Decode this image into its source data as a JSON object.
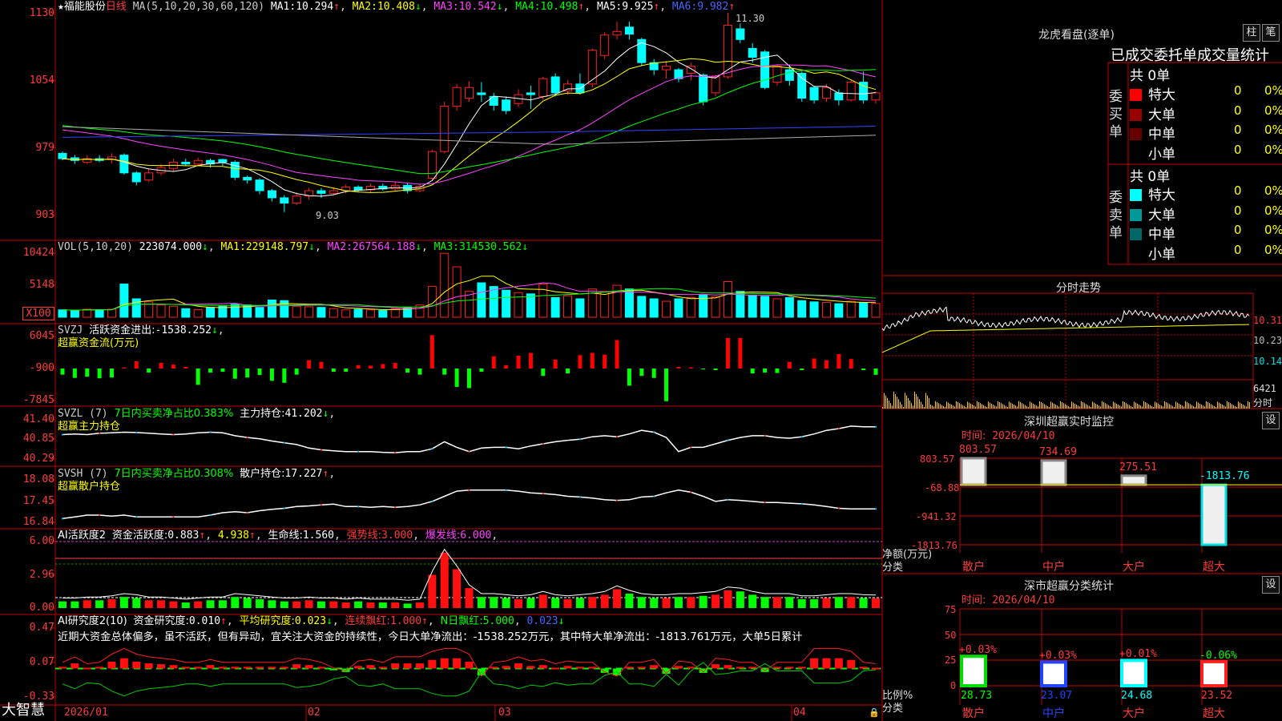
{
  "app_name": "大智慧",
  "colors": {
    "up": "#ff2020",
    "down": "#00ffff",
    "grid": "#c00000",
    "label": "#ff3b3b",
    "ma1": "#ffffff",
    "ma2": "#ffff00",
    "ma3": "#ff44ff",
    "ma4": "#00ff00",
    "ma5": "#3344ff",
    "ma6": "#aaaaaa"
  },
  "main": {
    "star": "★",
    "stock_name": "福能股份",
    "period": "日线",
    "ma_title": "MA(5,10,20,30,60,120)",
    "ma": [
      {
        "label": "MA1:",
        "value": "10.294",
        "arrow": "↑"
      },
      {
        "label": "MA2:",
        "value": "10.408",
        "arrow": "↓"
      },
      {
        "label": "MA3:",
        "value": "10.542",
        "arrow": "↓"
      },
      {
        "label": "MA4:",
        "value": "10.498",
        "arrow": "↑"
      },
      {
        "label": "MA5:",
        "value": "9.925",
        "arrow": "↑"
      },
      {
        "label": "MA6:",
        "value": "9.982",
        "arrow": "↑"
      }
    ],
    "y_ticks": [
      "1130",
      "1054",
      "979",
      "903"
    ],
    "high_label": "11.30",
    "low_label": "9.03"
  },
  "vol": {
    "title": "VOL(5,10,20)",
    "value": "223074.000",
    "arrow": "↓",
    "ma": [
      {
        "label": "MA1:",
        "value": "229148.797",
        "arrow": "↓"
      },
      {
        "label": "MA2:",
        "value": "267564.188",
        "arrow": "↓"
      },
      {
        "label": "MA3:",
        "value": "314530.562",
        "arrow": "↓"
      }
    ],
    "y_ticks": [
      "10424",
      "5148"
    ],
    "unit": "X100"
  },
  "svzj": {
    "title": "SVZJ",
    "desc": "活跃资金进出:",
    "value": "-1538.252",
    "arrow": "↓",
    "sub": "超赢资金流(万元)",
    "y_ticks": [
      "6045",
      "-900",
      "-7845"
    ]
  },
  "svzl": {
    "title": "SVZL (7)",
    "desc": "7日内买卖净占比0.383%",
    "label": "主力持仓:",
    "value": "41.202",
    "arrow": "↓",
    "sub": "超赢主力持仓",
    "y_ticks": [
      "41.40",
      "40.85",
      "40.29"
    ]
  },
  "svsh": {
    "title": "SVSH (7)",
    "desc": "7日内买卖净占比0.308%",
    "label": "散户持仓:",
    "value": "17.227",
    "arrow": "↑",
    "sub": "超赢散户持仓",
    "y_ticks": [
      "18.08",
      "17.45",
      "16.84"
    ]
  },
  "ai_active": {
    "title": "AI活跃度2",
    "label1": "资金活跃度:",
    "value1": "0.883",
    "value2": "4.938",
    "label3": "生命线:",
    "value3": "1.560",
    "label4": "强势线:",
    "value4": "3.000",
    "label5": "爆发线:",
    "value5": "6.000",
    "y_ticks": [
      "6.00",
      "2.96",
      "0.00"
    ]
  },
  "ai_research": {
    "title": "AI研究度2(10)",
    "label1": "资金研究度:",
    "value1": "0.010",
    "label2": "平均研究度:",
    "value2": "0.023",
    "label3": "连续飘红:",
    "value3": "1.000",
    "label4": "N日飘红:",
    "value4": "5.000",
    "value5": "0.023",
    "comment": "近期大资金总体偏多，虽不活跃，但有异动，宜关注大资金的持续性，今日大单净流出：-1538.252万元，其中特大单净流出：-1813.761万元，大单5日累计",
    "y_ticks": [
      "0.47",
      "0.07",
      "-0.33"
    ]
  },
  "x_axis": [
    "2026/01",
    "02",
    "03",
    "04"
  ],
  "right": {
    "dragon_title": "龙虎看盘(逐单)",
    "btn_zhu": "柱",
    "btn_bi": "笔",
    "stat_title": "已成交委托单成交量统计",
    "buy_label": "委买单",
    "sell_label": "委卖单",
    "buy_total": "共 0单",
    "sell_total": "共 0单",
    "buy_rows": [
      {
        "name": "特大",
        "qty": "0",
        "pct": "0%",
        "color": "#ff0000"
      },
      {
        "name": "大单",
        "qty": "0",
        "pct": "0%",
        "color": "#990000"
      },
      {
        "name": "中单",
        "qty": "0",
        "pct": "0%",
        "color": "#660000"
      },
      {
        "name": "小单",
        "qty": "0",
        "pct": "0%",
        "color": ""
      }
    ],
    "sell_rows": [
      {
        "name": "特大",
        "qty": "0",
        "pct": "0%",
        "color": "#00ffff"
      },
      {
        "name": "大单",
        "qty": "0",
        "pct": "0%",
        "color": "#009999"
      },
      {
        "name": "中单",
        "qty": "0",
        "pct": "0%",
        "color": "#006666"
      },
      {
        "name": "小单",
        "qty": "0",
        "pct": "0%",
        "color": ""
      }
    ],
    "intraday_title": "分时走势",
    "intraday_ticks": [
      "10.31",
      "10.23",
      "10.14"
    ],
    "intraday_vol": "6421",
    "intraday_unit": "分时",
    "sz_title": "深圳超赢实时监控",
    "sz_btn": "设",
    "sz_time_label": "时间:",
    "sz_time": "2026/04/10",
    "sz_y_ticks": [
      "803.57",
      "-68.88",
      "-941.32",
      "-1813.76"
    ],
    "sz_unit": "净额(万元)",
    "sz_cat_label": "分类",
    "categories": [
      "散户",
      "中户",
      "大户",
      "超大"
    ],
    "sz_values": [
      "803.57",
      "734.69",
      "275.51",
      "-1813.76"
    ],
    "cls_title": "深市超赢分类统计",
    "cls_btn": "设",
    "cls_time_label": "时间:",
    "cls_time": "2026/04/10",
    "cls_y_ticks": [
      "75",
      "50",
      "25",
      "0"
    ],
    "cls_unit": "比例%",
    "cls_cat_label": "分类",
    "cls_changes": [
      "+0.03%",
      "+0.03%",
      "+0.01%",
      "-0.06%"
    ],
    "cls_values": [
      "28.73",
      "23.07",
      "24.68",
      "23.52"
    ]
  },
  "chart_data": [
    {
      "type": "candlestick",
      "title": "福能股份 日线",
      "ylim": [
        9.03,
        11.3
      ],
      "y_ticks": [
        11.3,
        10.54,
        9.79,
        9.03
      ],
      "candles": [
        [
          9.72,
          9.66,
          9.74,
          9.64
        ],
        [
          9.67,
          9.64,
          9.7,
          9.6
        ],
        [
          9.62,
          9.66,
          9.7,
          9.6
        ],
        [
          9.66,
          9.64,
          9.7,
          9.62
        ],
        [
          9.65,
          9.68,
          9.72,
          9.61
        ],
        [
          9.7,
          9.5,
          9.72,
          9.48
        ],
        [
          9.5,
          9.4,
          9.52,
          9.36
        ],
        [
          9.42,
          9.5,
          9.54,
          9.4
        ],
        [
          9.5,
          9.56,
          9.6,
          9.47
        ],
        [
          9.55,
          9.62,
          9.66,
          9.52
        ],
        [
          9.62,
          9.6,
          9.66,
          9.58
        ],
        [
          9.6,
          9.64,
          9.67,
          9.58
        ],
        [
          9.64,
          9.6,
          9.66,
          9.56
        ],
        [
          9.65,
          9.62,
          9.66,
          9.58
        ],
        [
          9.62,
          9.45,
          9.64,
          9.42
        ],
        [
          9.45,
          9.42,
          9.47,
          9.38
        ],
        [
          9.42,
          9.3,
          9.44,
          9.26
        ],
        [
          9.3,
          9.22,
          9.32,
          9.18
        ],
        [
          9.22,
          9.16,
          9.25,
          9.06
        ],
        [
          9.16,
          9.24,
          9.28,
          9.14
        ],
        [
          9.24,
          9.3,
          9.33,
          9.2
        ],
        [
          9.3,
          9.27,
          9.33,
          9.22
        ],
        [
          9.27,
          9.3,
          9.34,
          9.25
        ],
        [
          9.3,
          9.34,
          9.37,
          9.27
        ],
        [
          9.34,
          9.31,
          9.36,
          9.28
        ],
        [
          9.31,
          9.35,
          9.38,
          9.28
        ],
        [
          9.35,
          9.32,
          9.38,
          9.3
        ],
        [
          9.32,
          9.36,
          9.4,
          9.29
        ],
        [
          9.36,
          9.3,
          9.38,
          9.27
        ],
        [
          9.3,
          9.35,
          9.38,
          9.28
        ],
        [
          9.44,
          9.74,
          9.76,
          9.42
        ],
        [
          9.74,
          10.25,
          10.3,
          9.72
        ],
        [
          10.25,
          10.46,
          10.5,
          10.2
        ],
        [
          10.34,
          10.46,
          10.53,
          10.3
        ],
        [
          10.4,
          10.38,
          10.52,
          10.3
        ],
        [
          10.36,
          10.26,
          10.4,
          10.2
        ],
        [
          10.32,
          10.2,
          10.36,
          10.16
        ],
        [
          10.28,
          10.38,
          10.44,
          10.24
        ],
        [
          10.4,
          10.38,
          10.48,
          10.22
        ],
        [
          10.36,
          10.56,
          10.58,
          10.32
        ],
        [
          10.58,
          10.4,
          10.62,
          10.36
        ],
        [
          10.42,
          10.5,
          10.54,
          10.38
        ],
        [
          10.5,
          10.4,
          10.62,
          10.38
        ],
        [
          10.5,
          10.88,
          10.9,
          10.46
        ],
        [
          10.82,
          11.05,
          11.08,
          10.78
        ],
        [
          11.05,
          11.09,
          11.2,
          11.0
        ],
        [
          11.14,
          11.06,
          11.2,
          11.0
        ],
        [
          11.0,
          10.74,
          11.02,
          10.7
        ],
        [
          10.74,
          10.66,
          10.78,
          10.6
        ],
        [
          10.66,
          10.7,
          10.76,
          10.56
        ],
        [
          10.66,
          10.56,
          10.68,
          10.52
        ],
        [
          10.62,
          10.7,
          10.74,
          10.54
        ],
        [
          10.6,
          10.3,
          10.62,
          10.26
        ],
        [
          10.4,
          10.58,
          10.6,
          10.36
        ],
        [
          10.58,
          11.16,
          11.3,
          10.56
        ],
        [
          11.12,
          11.0,
          11.18,
          10.96
        ],
        [
          10.9,
          10.8,
          10.96,
          10.74
        ],
        [
          10.86,
          10.46,
          10.88,
          10.44
        ],
        [
          10.52,
          10.7,
          10.72,
          10.48
        ],
        [
          10.66,
          10.54,
          10.72,
          10.48
        ],
        [
          10.62,
          10.34,
          10.64,
          10.3
        ],
        [
          10.46,
          10.32,
          10.48,
          10.28
        ],
        [
          10.34,
          10.46,
          10.5,
          10.3
        ],
        [
          10.4,
          10.32,
          10.44,
          10.26
        ],
        [
          10.32,
          10.52,
          10.54,
          10.3
        ],
        [
          10.52,
          10.32,
          10.64,
          10.28
        ],
        [
          10.32,
          10.4,
          10.42,
          10.28
        ]
      ]
    },
    {
      "type": "bar",
      "title": "VOL(5,10,20)",
      "ylim": [
        0,
        10424
      ],
      "values": [
        1200,
        1100,
        1300,
        1250,
        1300,
        5400,
        3000,
        2500,
        2000,
        1800,
        1400,
        1250,
        1600,
        1800,
        2100,
        2000,
        1600,
        2800,
        2700,
        1800,
        1700,
        1600,
        1400,
        1200,
        1300,
        1200,
        1100,
        1400,
        1600,
        2000,
        5000,
        10400,
        8200,
        4200,
        5600,
        5000,
        4400,
        4000,
        3800,
        5400,
        3200,
        3500,
        3000,
        4600,
        4200,
        5200,
        4600,
        3400,
        3000,
        2600,
        3000,
        3200,
        3600,
        3300,
        5800,
        4200,
        3600,
        3400,
        3000,
        3200,
        2700,
        2500,
        2400,
        2200,
        2600,
        2400,
        2230
      ]
    },
    {
      "type": "bar",
      "title": "超赢资金流(万元)",
      "ylim": [
        -7845,
        6045
      ],
      "values": [
        -1500,
        -2300,
        -2000,
        -2400,
        -2200,
        200,
        1300,
        -1000,
        1000,
        700,
        300,
        -4000,
        -1000,
        -800,
        -2500,
        -2200,
        -1600,
        -3000,
        -3500,
        -1500,
        1500,
        1200,
        -800,
        -800,
        600,
        500,
        800,
        1000,
        -1000,
        -1500,
        6000,
        -1500,
        -4500,
        -4800,
        -800,
        2200,
        600,
        2300,
        2800,
        -1800,
        1600,
        -1200,
        2400,
        2800,
        2500,
        5100,
        -4200,
        -1800,
        -2300,
        -8000,
        300,
        200,
        -200,
        -400,
        5500,
        5500,
        -1200,
        -1000,
        -1100,
        1200,
        -400,
        1800,
        1500,
        2600,
        1700,
        -400,
        -1538
      ]
    },
    {
      "type": "line",
      "title": "超赢主力持仓",
      "ylim": [
        40.29,
        41.4
      ],
      "values": [
        40.98,
        41.0,
        40.98,
        41.02,
        41.03,
        41.05,
        41.04,
        41.02,
        41.0,
        40.98,
        41.0,
        41.03,
        41.05,
        41.03,
        40.95,
        40.9,
        40.86,
        40.8,
        40.75,
        40.7,
        40.6,
        40.55,
        40.52,
        40.5,
        40.5,
        40.5,
        40.48,
        40.47,
        40.5,
        40.5,
        40.58,
        40.78,
        40.62,
        40.5,
        40.6,
        40.62,
        40.62,
        40.58,
        40.66,
        40.72,
        40.78,
        40.82,
        40.85,
        40.92,
        40.95,
        40.92,
        41.0,
        41.1,
        41.05,
        40.9,
        40.5,
        40.62,
        40.62,
        40.72,
        40.82,
        40.9,
        40.95,
        40.95,
        40.9,
        40.88,
        40.92,
        41.0,
        41.1,
        41.15,
        41.22,
        41.2,
        41.2
      ]
    },
    {
      "type": "line",
      "title": "超赢散户持仓",
      "ylim": [
        16.84,
        18.08
      ],
      "values": [
        16.95,
        17.0,
        17.05,
        17.05,
        17.02,
        17.05,
        17.0,
        17.0,
        17.0,
        17.0,
        17.0,
        17.0,
        17.05,
        17.12,
        17.15,
        17.12,
        17.18,
        17.22,
        17.25,
        17.3,
        17.32,
        17.35,
        17.37,
        17.3,
        17.3,
        17.28,
        17.3,
        17.28,
        17.3,
        17.35,
        17.45,
        17.6,
        17.75,
        17.78,
        17.78,
        17.78,
        17.78,
        17.75,
        17.7,
        17.68,
        17.65,
        17.6,
        17.58,
        17.55,
        17.5,
        17.48,
        17.5,
        17.58,
        17.6,
        17.7,
        17.78,
        17.72,
        17.6,
        17.45,
        17.5,
        17.48,
        17.45,
        17.42,
        17.42,
        17.4,
        17.38,
        17.35,
        17.3,
        17.25,
        17.23,
        17.23,
        17.23
      ]
    },
    {
      "type": "bar",
      "title": "AI活跃度2",
      "ylim": [
        0,
        6.0
      ],
      "values": [
        0.6,
        0.6,
        0.7,
        0.7,
        0.8,
        1.0,
        0.9,
        0.7,
        0.7,
        0.6,
        0.5,
        0.6,
        0.7,
        0.7,
        1.0,
        0.9,
        0.8,
        0.7,
        0.6,
        0.6,
        0.7,
        0.6,
        0.6,
        0.5,
        0.6,
        0.5,
        0.5,
        0.5,
        0.4,
        0.5,
        3.0,
        5.0,
        3.5,
        1.8,
        1.0,
        1.0,
        0.9,
        0.8,
        0.9,
        1.2,
        0.9,
        0.8,
        0.9,
        1.0,
        1.2,
        1.7,
        1.3,
        1.0,
        0.9,
        0.9,
        1.0,
        1.0,
        1.1,
        1.2,
        1.6,
        1.5,
        1.2,
        1.0,
        1.0,
        1.0,
        0.8,
        0.8,
        0.9,
        1.0,
        1.0,
        0.9,
        0.88
      ]
    },
    {
      "type": "bar",
      "title": "AI研究度2(10)",
      "ylim": [
        -0.33,
        0.47
      ],
      "values": [
        0.02,
        0.06,
        0.01,
        0.02,
        0.08,
        0.12,
        0.08,
        0.06,
        0.05,
        0.04,
        0.02,
        0.02,
        0.04,
        0.02,
        0.02,
        0.02,
        0.02,
        0.02,
        0.02,
        0.05,
        0.04,
        0.02,
        -0.02,
        -0.04,
        0.03,
        0.04,
        0.02,
        0.06,
        0.06,
        0.06,
        0.1,
        0.12,
        0.12,
        0.08,
        -0.08,
        0.02,
        0.03,
        0.06,
        0.03,
        0.04,
        0.01,
        0.03,
        0.02,
        0.02,
        -0.05,
        -0.08,
        0.02,
        0.02,
        0.04,
        -0.06,
        0.03,
        0.02,
        -0.05,
        0.05,
        0.04,
        0.02,
        0.02,
        -0.04,
        0.02,
        0.02,
        0.02,
        0.12,
        0.12,
        0.12,
        0.1,
        0.02,
        0.01
      ]
    }
  ]
}
